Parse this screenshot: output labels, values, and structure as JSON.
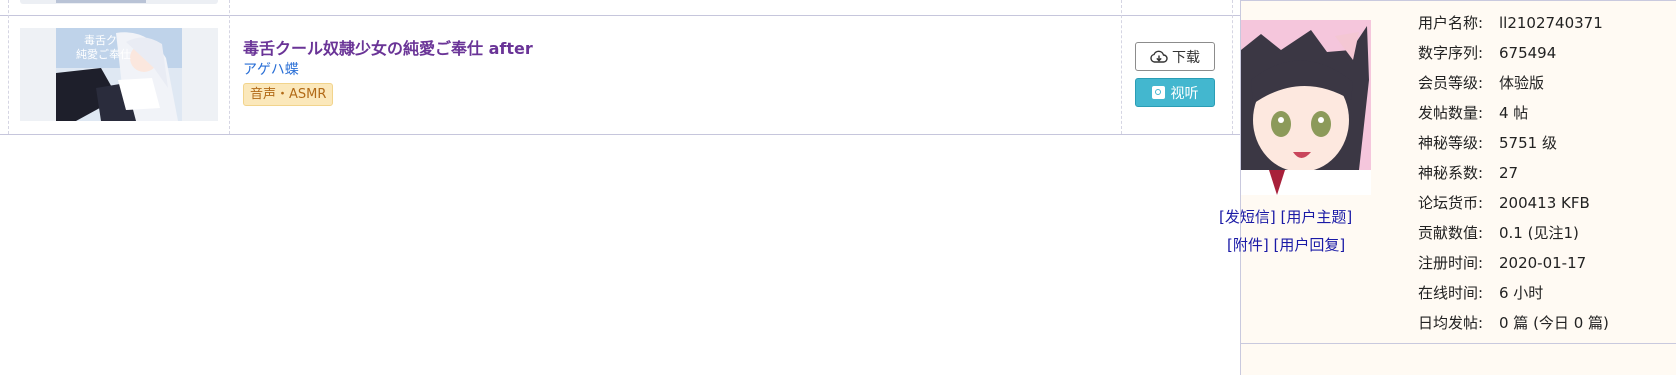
{
  "item": {
    "title": "毒舌クール奴隷少女の純愛ご奉仕 after",
    "author": "アゲハ蝶",
    "tag": "音声・ASMR",
    "download_label": "下载",
    "listen_label": "视听"
  },
  "user": {
    "link_pm": "[发短信]",
    "link_topics": "[用户主题]",
    "link_attachments": "[附件]",
    "link_replies": "[用户回复]",
    "fields": [
      {
        "label": "用户名称:",
        "value": "ll2102740371"
      },
      {
        "label": "数字序列:",
        "value": "675494"
      },
      {
        "label": "会员等级:",
        "value": "体验版"
      },
      {
        "label": "发帖数量:",
        "value": "4 帖"
      },
      {
        "label": "神秘等级:",
        "value": "5751 级"
      },
      {
        "label": "神秘系数:",
        "value": "27"
      },
      {
        "label": "论坛货币:",
        "value": "200413 KFB"
      },
      {
        "label": "贡献数值:",
        "value": "0.1 (见注1)"
      },
      {
        "label": "注册时间:",
        "value": "2020-01-17"
      },
      {
        "label": "在线时间:",
        "value": "6 小时"
      },
      {
        "label": "日均发帖:",
        "value": "0 篇 (今日 0 篇)"
      }
    ]
  },
  "colors": {
    "title": "#6a3497",
    "author": "#2a6fd6",
    "tag_bg": "#fbe8bb",
    "listen_bg": "#43b7cf",
    "popup_bg": "#fffaf3",
    "link": "#1a1aa6"
  }
}
